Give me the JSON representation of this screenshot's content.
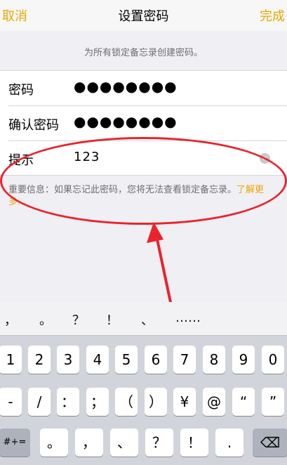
{
  "nav": {
    "cancel": "取消",
    "title": "设置密码",
    "done": "完成"
  },
  "subtitle": "为所有锁定备忘录创建密码。",
  "form": {
    "rows": [
      {
        "label": "密码",
        "value": "●●●●●●●●"
      },
      {
        "label": "确认密码",
        "value": "●●●●●●●●"
      },
      {
        "label": "提示",
        "value": "123"
      }
    ],
    "clear_icon": "×"
  },
  "note": {
    "text": "重要信息：如果忘记此密码，您将无法查看锁定备忘录。",
    "link": "了解更多..."
  },
  "keyboard": {
    "candidates": [
      "，",
      "。",
      "？",
      "！",
      "、",
      "……"
    ],
    "row1": [
      "1",
      "2",
      "3",
      "4",
      "5",
      "6",
      "7",
      "8",
      "9",
      "0"
    ],
    "row2": [
      "-",
      "/",
      "：",
      "；",
      "（",
      "）",
      "¥",
      "@",
      "“",
      "”"
    ],
    "row3": [
      "#+=",
      "。",
      "，",
      "、",
      "？",
      "！",
      ".",
      ""
    ],
    "delete_icon": "⌫"
  },
  "colors": {
    "accent": "#e9a800",
    "annotation": "#e8242c"
  }
}
